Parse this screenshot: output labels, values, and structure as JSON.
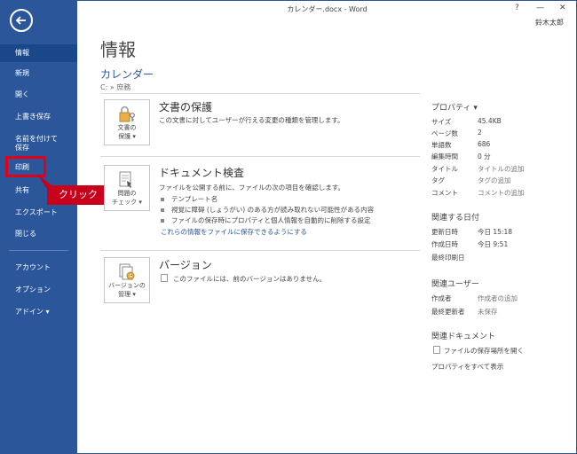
{
  "window": {
    "title": "カレンダー.docx - Word",
    "help": "?",
    "minimize": "—",
    "close": "✕",
    "user": "鈴木太郎"
  },
  "sidebar": {
    "items": [
      {
        "label": "情報"
      },
      {
        "label": "新規"
      },
      {
        "label": "開く"
      },
      {
        "label": "上書き保存"
      },
      {
        "label": "名前を付けて"
      },
      {
        "label": "保存"
      },
      {
        "label": "印刷"
      },
      {
        "label": "共有"
      },
      {
        "label": "エクスポート"
      },
      {
        "label": "閉じる"
      },
      {
        "label": "アカウント"
      },
      {
        "label": "オプション"
      },
      {
        "label": "アドイン ▾"
      }
    ],
    "callout": "クリック"
  },
  "main": {
    "title": "情報",
    "doc_name": "カレンダー",
    "doc_path": "C: » 庶務",
    "protect": {
      "btn1": "文書の",
      "btn2": "保護 ▾",
      "title": "文書の保護",
      "desc": "この文書に対してユーザーが行える変更の種類を管理します。"
    },
    "inspect": {
      "btn1": "問題の",
      "btn2": "チェック ▾",
      "title": "ドキュメント検査",
      "desc": "ファイルを公開する前に、ファイルの次の項目を確認します。",
      "bullets": [
        "テンプレート名",
        "視覚に障碍 (しょうがい) のある方が読み取れない可能性がある内容",
        "ファイルの保存時にプロパティと個人情報を自動的に削除する設定"
      ],
      "link": "これらの情報をファイルに保存できるようにする"
    },
    "versions": {
      "btn1": "バージョンの",
      "btn2": "管理 ▾",
      "title": "バージョン",
      "desc": "このファイルには、前のバージョンはありません。"
    }
  },
  "properties": {
    "head": "プロパティ ▾",
    "rows": [
      {
        "label": "サイズ",
        "value": "45.4KB"
      },
      {
        "label": "ページ数",
        "value": "2"
      },
      {
        "label": "単語数",
        "value": "686"
      },
      {
        "label": "編集時間",
        "value": "0 分"
      },
      {
        "label": "タイトル",
        "value": "タイトルの追加"
      },
      {
        "label": "タグ",
        "value": "タグの追加"
      },
      {
        "label": "コメント",
        "value": "コメントの追加"
      }
    ],
    "dates_head": "関連する日付",
    "dates": [
      {
        "label": "更新日時",
        "value": "今日 15:18"
      },
      {
        "label": "作成日時",
        "value": "今日 9:51"
      },
      {
        "label": "最終印刷日",
        "value": ""
      }
    ],
    "users_head": "関連ユーザー",
    "users": [
      {
        "label": "作成者",
        "value": "作成者の追加"
      },
      {
        "label": "最終更新者",
        "value": "未保存"
      }
    ],
    "docs_head": "関連ドキュメント",
    "open_location": "ファイルの保存場所を開く",
    "show_all": "プロパティをすべて表示"
  }
}
